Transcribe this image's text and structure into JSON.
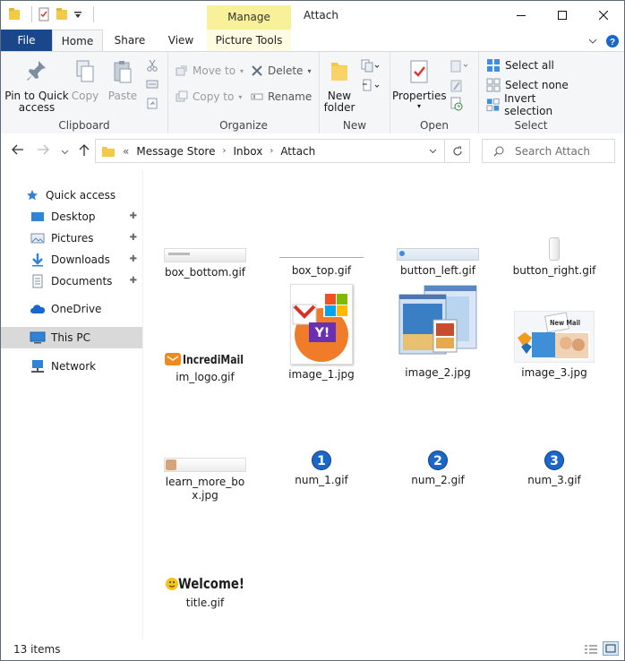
{
  "window": {
    "title": "Attach",
    "contextual_tab": "Manage"
  },
  "ribbon_tabs": [
    "File",
    "Home",
    "Share",
    "View",
    "Picture Tools"
  ],
  "ribbon": {
    "clipboard": {
      "label": "Clipboard",
      "pin": "Pin to Quick access",
      "copy": "Copy",
      "paste": "Paste"
    },
    "organize": {
      "label": "Organize",
      "move_to": "Move to",
      "copy_to": "Copy to",
      "delete": "Delete",
      "rename": "Rename"
    },
    "new": {
      "label": "New",
      "new_folder": "New folder"
    },
    "open": {
      "label": "Open",
      "properties": "Properties"
    },
    "select": {
      "label": "Select",
      "select_all": "Select all",
      "select_none": "Select none",
      "invert": "Invert selection"
    }
  },
  "address": {
    "prefix": "«",
    "crumbs": [
      "Message Store",
      "Inbox",
      "Attach"
    ]
  },
  "search": {
    "placeholder": "Search Attach"
  },
  "nav": {
    "quick_access": "Quick access",
    "items": [
      "Desktop",
      "Pictures",
      "Downloads",
      "Documents"
    ],
    "onedrive": "OneDrive",
    "thispc": "This PC",
    "network": "Network"
  },
  "files": [
    {
      "name": "box_bottom.gif"
    },
    {
      "name": "box_top.gif"
    },
    {
      "name": "button_left.gif"
    },
    {
      "name": "button_right.gif"
    },
    {
      "name": "im_logo.gif",
      "logo_text": "IncrediMail"
    },
    {
      "name": "image_1.jpg"
    },
    {
      "name": "image_2.jpg"
    },
    {
      "name": "image_3.jpg",
      "badge_text": "New Mail"
    },
    {
      "name": "learn_more_box.jpg"
    },
    {
      "name": "num_1.gif",
      "digit": "1"
    },
    {
      "name": "num_2.gif",
      "digit": "2"
    },
    {
      "name": "num_3.gif",
      "digit": "3"
    },
    {
      "name": "title.gif",
      "logo_text": "Welcome!"
    }
  ],
  "status": {
    "count": "13 items"
  },
  "colors": {
    "file_tab": "#19478a",
    "manage_tab": "#f8f19a",
    "accent": "#0078d7",
    "num_badge": "#1a66c9"
  }
}
